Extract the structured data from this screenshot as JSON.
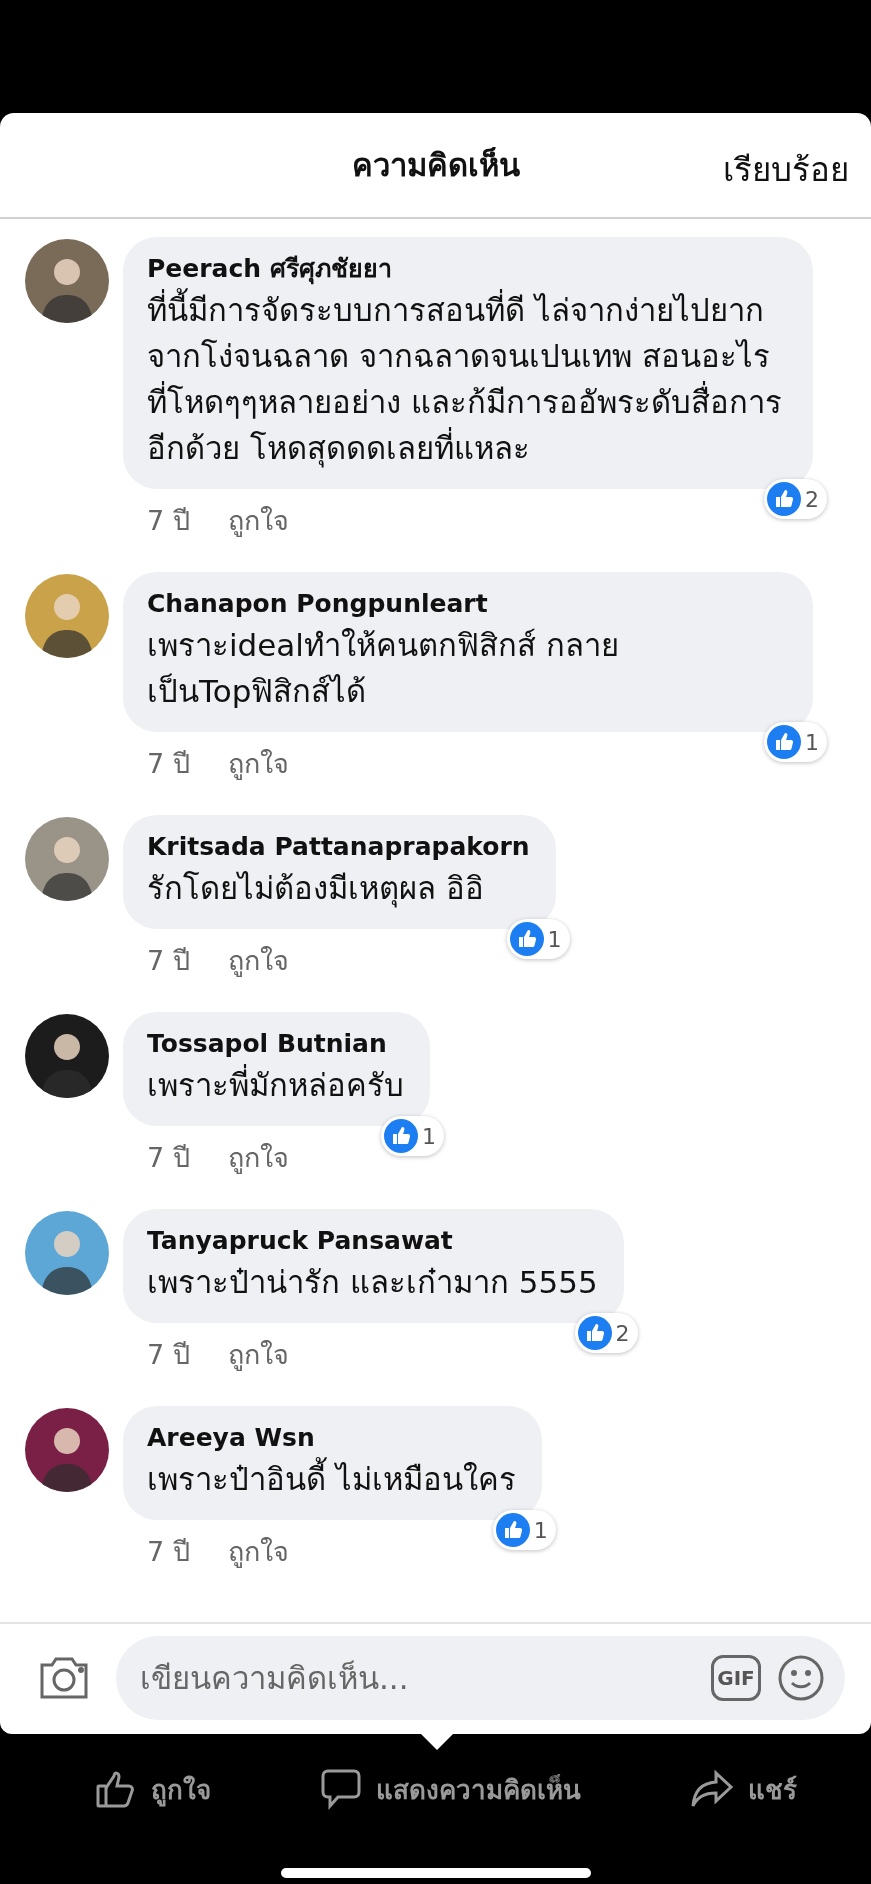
{
  "header": {
    "title": "ความคิดเห็น",
    "done": "เรียบร้อย"
  },
  "comments": [
    {
      "name": "Peerach ศรีศุภชัยยา",
      "text": "ที่นี้มีการจัดระบบการสอนที่ดี ไล่จากง่ายไปยาก จากโง่จนฉลาด จากฉลาดจนเปนเทพ สอนอะไรที่โหดๆๆหลายอย่าง และก้มีการออัพระดับสื่อการอีกด้วย โหดสุดดดเลยที่แหละ",
      "time": "7 ปี",
      "like": "ถูกใจ",
      "reactions": "2"
    },
    {
      "name": "Chanapon Pongpunleart",
      "text": "เพราะidealทำให้คนตกฟิสิกส์ กลายเป็นTopฟิสิกส์ได้",
      "time": "7 ปี",
      "like": "ถูกใจ",
      "reactions": "1"
    },
    {
      "name": "Kritsada Pattanaprapakorn",
      "text": "รักโดยไม่ต้องมีเหตุผล อิอิ",
      "time": "7 ปี",
      "like": "ถูกใจ",
      "reactions": "1"
    },
    {
      "name": "Tossapol Butnian",
      "text": "เพราะพี่มักหล่อครับ",
      "time": "7 ปี",
      "like": "ถูกใจ",
      "reactions": "1"
    },
    {
      "name": "Tanyapruck Pansawat",
      "text": "เพราะป๋าน่ารัก และเก๋ามาก 5555",
      "time": "7 ปี",
      "like": "ถูกใจ",
      "reactions": "2"
    },
    {
      "name": "Areeya Wsn",
      "text": "เพราะป๋าอินดี้ ไม่เหมือนใคร",
      "time": "7 ปี",
      "like": "ถูกใจ",
      "reactions": "1"
    }
  ],
  "composer": {
    "placeholder": "เขียนความคิดเห็น...",
    "gif": "GIF"
  },
  "actions": [
    {
      "kind": "like",
      "label": "ถูกใจ"
    },
    {
      "kind": "comment",
      "label": "แสดงความคิดเห็น"
    },
    {
      "kind": "share",
      "label": "แชร์"
    }
  ]
}
